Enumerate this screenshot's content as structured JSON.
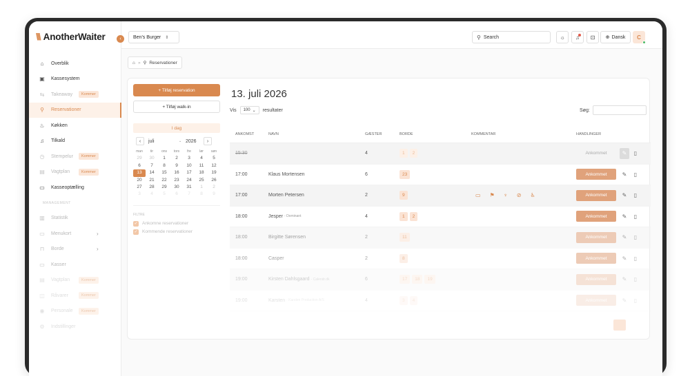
{
  "brand": {
    "logo_mark": "\\\\\\",
    "name": "AnotherWaiter"
  },
  "sidebar": {
    "items": [
      {
        "label": "Overblik",
        "icon": "home-icon",
        "glyph": "⌂",
        "state": "normal"
      },
      {
        "label": "Kassesystem",
        "icon": "register-icon",
        "glyph": "▣",
        "state": "normal"
      },
      {
        "label": "Takeaway",
        "icon": "takeaway-icon",
        "glyph": "⇆",
        "state": "dim",
        "badge": "Kommer"
      },
      {
        "label": "Reservationer",
        "icon": "reservation-icon",
        "glyph": "⚲",
        "state": "active"
      },
      {
        "label": "Køkken",
        "icon": "kitchen-icon",
        "glyph": "♨",
        "state": "normal"
      },
      {
        "label": "Tilkald",
        "icon": "bell-icon",
        "glyph": "♫",
        "state": "normal"
      },
      {
        "label": "Stempelur",
        "icon": "clock-icon",
        "glyph": "◷",
        "state": "dim",
        "badge": "Kommer"
      },
      {
        "label": "Vagtplan",
        "icon": "calendar-icon",
        "glyph": "▤",
        "state": "dim",
        "badge": "Kommer"
      },
      {
        "label": "Kasseoptælling",
        "icon": "cash-count-icon",
        "glyph": "▭",
        "state": "normal"
      }
    ],
    "section_label": "MANAGEMENT",
    "management_items": [
      {
        "label": "Statistik",
        "icon": "chart-icon",
        "glyph": "▥",
        "state": "dim"
      },
      {
        "label": "Menukort",
        "icon": "menu-icon",
        "glyph": "▭",
        "state": "dim",
        "chevron": "›"
      },
      {
        "label": "Borde",
        "icon": "table-icon",
        "glyph": "⊓",
        "state": "dim",
        "chevron": "›"
      },
      {
        "label": "Kasser",
        "icon": "cashier-icon",
        "glyph": "▭",
        "state": "dim"
      },
      {
        "label": "Vagtplan",
        "icon": "calendar-icon",
        "glyph": "▤",
        "state": "faint",
        "badge": "Kommer"
      },
      {
        "label": "Råvarer",
        "icon": "stock-icon",
        "glyph": "◫",
        "state": "faint",
        "badge": "Kommer"
      },
      {
        "label": "Personale",
        "icon": "staff-icon",
        "glyph": "◉",
        "state": "faint",
        "badge": "Kommer"
      },
      {
        "label": "Indstillinger",
        "icon": "gear-icon",
        "glyph": "⚙",
        "state": "faint"
      }
    ]
  },
  "topbar": {
    "restaurant": "Ben's Burger",
    "search_label": "Search",
    "language": "Dansk",
    "avatar_initial": "C"
  },
  "breadcrumb": {
    "page": "Reservationer"
  },
  "actions": {
    "add_reservation": "+ Tilføj reservation",
    "add_walkin": "+ Tilføj walk-in"
  },
  "calendar": {
    "today_label": "I dag",
    "month": "juli",
    "year": "2026",
    "weekdays": [
      "man",
      "tir",
      "ons",
      "tors",
      "fre",
      "lør",
      "søn"
    ],
    "days": [
      [
        "29",
        "30",
        "1",
        "2",
        "3",
        "4",
        "5"
      ],
      [
        "6",
        "7",
        "8",
        "9",
        "10",
        "11",
        "12"
      ],
      [
        "13",
        "14",
        "15",
        "16",
        "17",
        "18",
        "19"
      ],
      [
        "20",
        "21",
        "22",
        "23",
        "24",
        "25",
        "26"
      ],
      [
        "27",
        "28",
        "29",
        "30",
        "31",
        "1",
        "2"
      ],
      [
        "3",
        "4",
        "5",
        "6",
        "7",
        "8",
        "9"
      ]
    ],
    "selected_day": "13"
  },
  "filters": {
    "title": "FILTRE",
    "items": [
      "Ankomne reservationer",
      "Kommende reservationer"
    ]
  },
  "page": {
    "title": "13. juli 2026",
    "show_label": "Vis",
    "page_size": "100",
    "results_label": "resultater",
    "search_label": "Søg:"
  },
  "table": {
    "headers": [
      "ANKOMST",
      "NAVN",
      "GÆSTER",
      "BORDE",
      "KOMMENTAR",
      "HANDLINGER"
    ],
    "rows": [
      {
        "time": "15:30",
        "name": "",
        "sub": "",
        "guests": "4",
        "tables": [
          "1",
          "2"
        ],
        "status": "Ankommet",
        "arrived": true,
        "style": "grey",
        "fade": ""
      },
      {
        "time": "17:00",
        "name": "Klaus Mortensen",
        "sub": "",
        "guests": "6",
        "tables": [
          "23"
        ],
        "status": "Ankommet",
        "arrived": false,
        "style": "",
        "fade": ""
      },
      {
        "time": "17:00",
        "name": "Morten Petersen",
        "sub": "",
        "guests": "2",
        "tables": [
          "9"
        ],
        "status": "Ankommet",
        "arrived": false,
        "style": "grey",
        "fade": "",
        "comments": true
      },
      {
        "time": "18:00",
        "name": "Jesper",
        "sub": "- Dominant",
        "guests": "4",
        "tables": [
          "1",
          "2"
        ],
        "status": "Ankommet",
        "arrived": false,
        "style": "",
        "fade": ""
      },
      {
        "time": "18:00",
        "name": "Birgitte Sørensen",
        "sub": "",
        "guests": "2",
        "tables": [
          "11"
        ],
        "status": "Ankommet",
        "arrived": false,
        "style": "grey",
        "fade": "f1"
      },
      {
        "time": "18:00",
        "name": "Casper",
        "sub": "",
        "guests": "2",
        "tables": [
          "8"
        ],
        "status": "Ankommet",
        "arrived": false,
        "style": "",
        "fade": "f1"
      },
      {
        "time": "19:00",
        "name": "Kirsten Dahlsgaard",
        "sub": "- Calendr.dk",
        "guests": "6",
        "tables": [
          "17",
          "18",
          "19"
        ],
        "status": "Ankommet",
        "arrived": false,
        "style": "grey",
        "fade": "f2"
      },
      {
        "time": "19:00",
        "name": "Karsten",
        "sub": "- Karsten Production A/S",
        "guests": "4",
        "tables": [
          "3",
          "4"
        ],
        "status": "Ankommet",
        "arrived": false,
        "style": "",
        "fade": "f3"
      }
    ],
    "comment_icons": [
      "chat-icon",
      "flag-icon",
      "cake-icon",
      "no-gluten-icon",
      "wheelchair-icon"
    ],
    "comment_glyphs": [
      "▭",
      "⚑",
      "♆",
      "⊘",
      "♿"
    ]
  },
  "colors": {
    "accent": "#d9894f",
    "accent_light": "#fbe6d8",
    "button": "#e0a27b"
  }
}
